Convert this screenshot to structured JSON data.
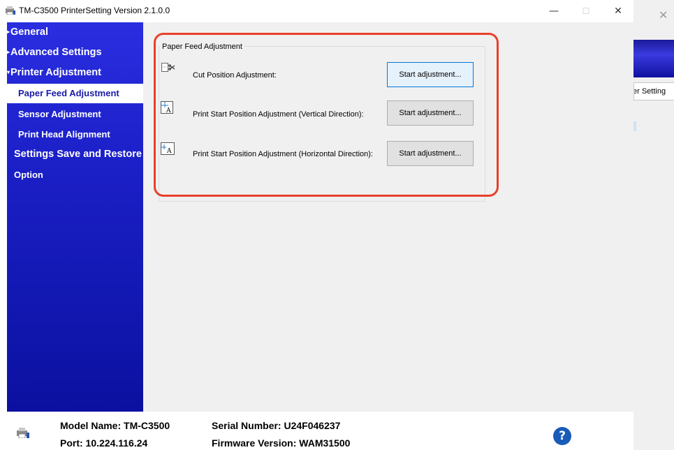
{
  "window": {
    "title": "TM-C3500 PrinterSetting Version 2.1.0.0",
    "controls": {
      "minimize": "—",
      "maximize": "☐",
      "close": "✕"
    }
  },
  "background_window": {
    "close": "✕",
    "tab_label": "er Setting"
  },
  "sidebar": {
    "items": [
      {
        "label": "General",
        "expander": "▸"
      },
      {
        "label": "Advanced Settings",
        "expander": "▸"
      },
      {
        "label": "Printer Adjustment",
        "expander": "▾"
      },
      {
        "label": "Paper Feed Adjustment",
        "selected": true
      },
      {
        "label": "Sensor Adjustment"
      },
      {
        "label": "Print Head Alignment"
      },
      {
        "label": "Settings Save and Restore"
      },
      {
        "label": "Option"
      }
    ]
  },
  "main": {
    "group_title": "Paper Feed Adjustment",
    "rows": [
      {
        "icon": "cut-position-icon",
        "label": "Cut Position Adjustment:",
        "button": "Start adjustment..."
      },
      {
        "icon": "vertical-position-icon",
        "label": "Print Start Position Adjustment (Vertical Direction):",
        "button": "Start adjustment..."
      },
      {
        "icon": "horizontal-position-icon",
        "label": "Print Start Position Adjustment (Horizontal Direction):",
        "button": "Start adjustment..."
      }
    ]
  },
  "footer": {
    "model": "Model Name: TM-C3500",
    "port": "Port: 10.224.116.24",
    "serial": "Serial Number: U24F046237",
    "firmware": "Firmware Version: WAM31500",
    "help_icon": "?"
  },
  "colors": {
    "sidebar": "#1c20c8",
    "highlight": "#e8402a",
    "help": "#1a5bb8"
  }
}
